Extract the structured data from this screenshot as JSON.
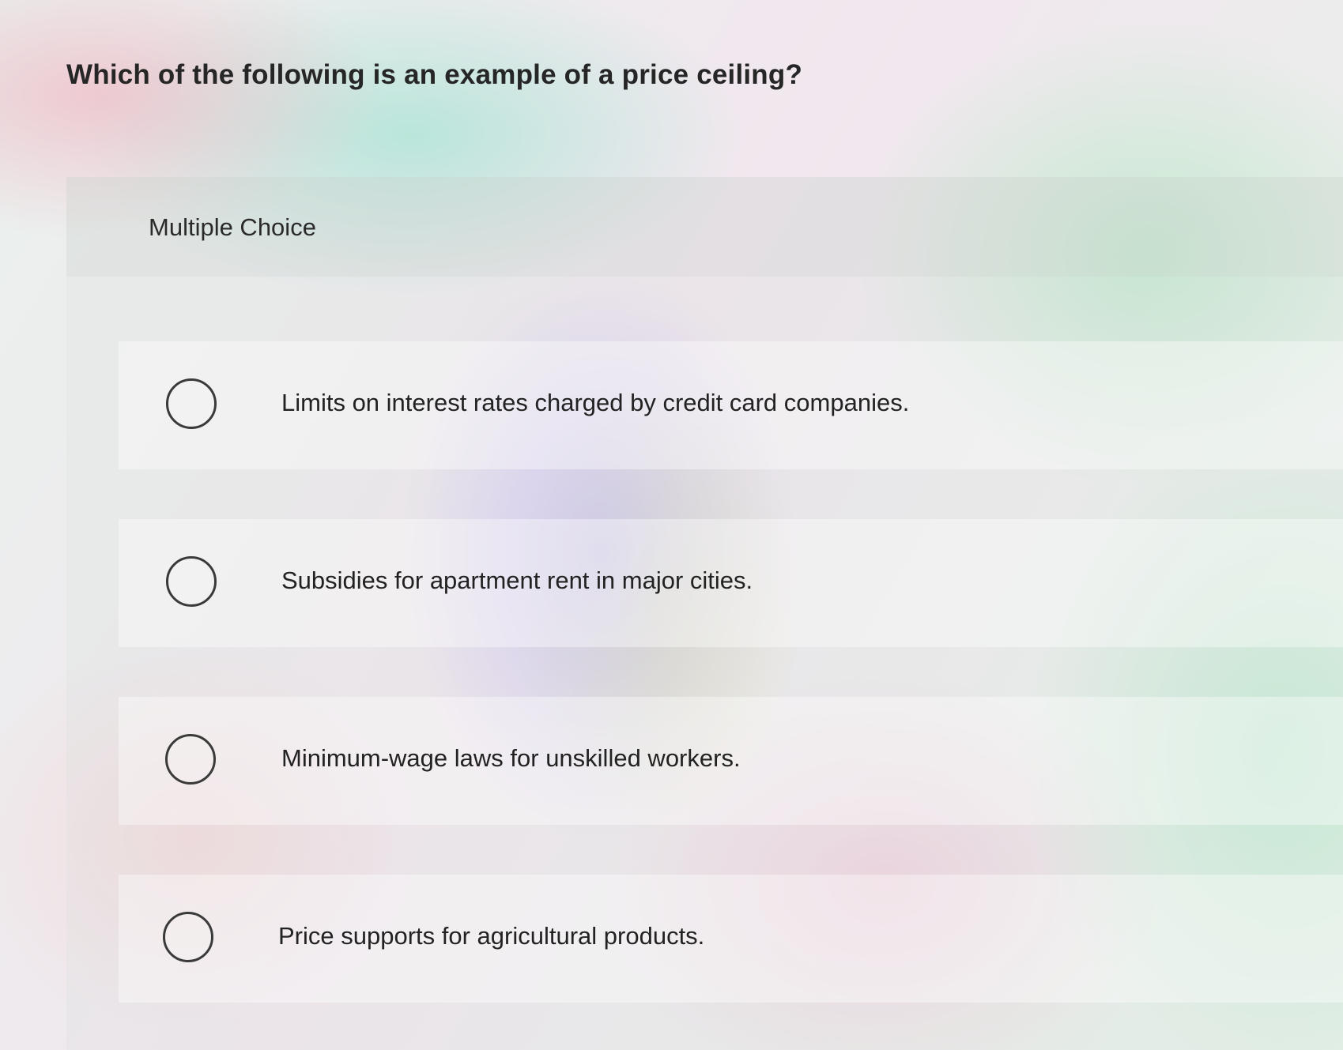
{
  "question": {
    "title": "Which of the following is an example of a price ceiling?"
  },
  "multiple_choice": {
    "label": "Multiple Choice",
    "options": [
      {
        "label": "Limits on interest rates charged by credit card companies.",
        "selected": false
      },
      {
        "label": "Subsidies for apartment rent in major cities.",
        "selected": false
      },
      {
        "label": "Minimum-wage laws for unskilled workers.",
        "selected": false
      },
      {
        "label": "Price supports for agricultural products.",
        "selected": false
      }
    ]
  }
}
